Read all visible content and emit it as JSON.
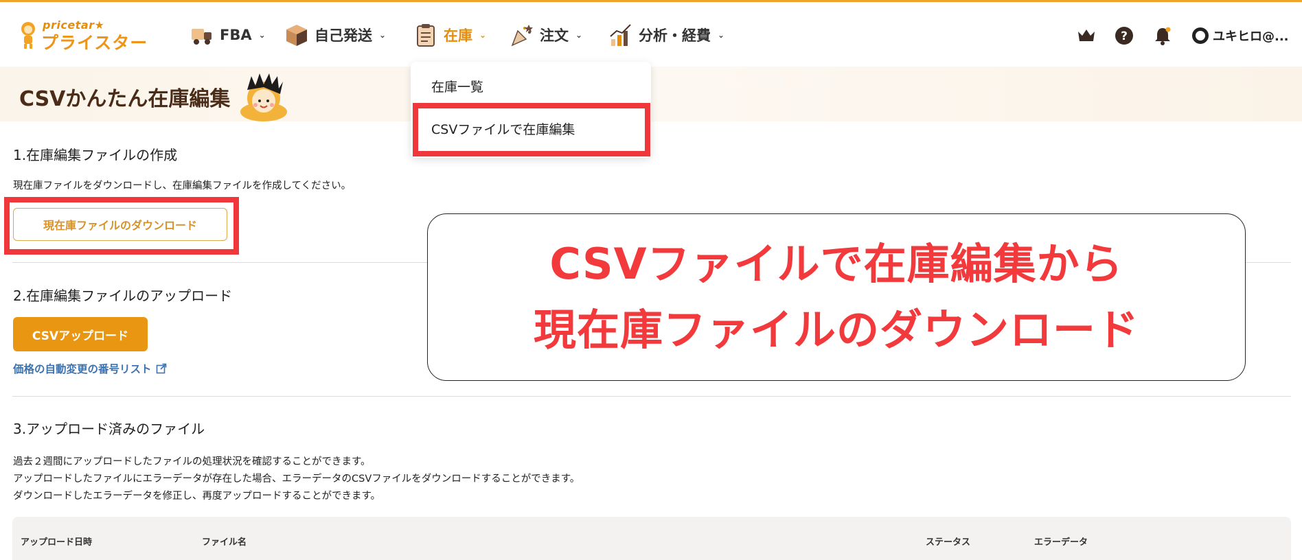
{
  "brand": {
    "logo_small": "pricetar★",
    "logo_big": "プライスター"
  },
  "nav": [
    {
      "label": "FBA",
      "icon": "truck-icon"
    },
    {
      "label": "自己発送",
      "icon": "box-icon"
    },
    {
      "label": "在庫",
      "icon": "clipboard-icon",
      "active": true
    },
    {
      "label": "注文",
      "icon": "party-popper-icon"
    },
    {
      "label": "分析・経費",
      "icon": "chart-icon"
    }
  ],
  "header_icons": [
    "crown-icon",
    "help-icon",
    "bell-icon"
  ],
  "user": {
    "name": "ユキヒロ@..."
  },
  "page": {
    "title": "CSVかんたん在庫編集"
  },
  "dropdown": {
    "items": [
      "在庫一覧",
      "CSVファイルで在庫編集"
    ]
  },
  "section1": {
    "heading": "1.在庫編集ファイルの作成",
    "description": "現在庫ファイルをダウンロードし、在庫編集ファイルを作成してください。",
    "button": "現在庫ファイルのダウンロード"
  },
  "section2": {
    "heading": "2.在庫編集ファイルのアップロード",
    "button": "CSVアップロード",
    "link": "価格の自動変更の番号リスト"
  },
  "section3": {
    "heading": "3.アップロード済みのファイル",
    "lines": [
      "過去２週間にアップロードしたファイルの処理状況を確認することができます。",
      "アップロードしたファイルにエラーデータが存在した場合、エラーデータのCSVファイルをダウンロードすることができます。",
      "ダウンロードしたエラーデータを修正し、再度アップロードすることができます。"
    ],
    "table_headers": [
      "アップロード日時",
      "ファイル名",
      "ステータス",
      "エラーデータ"
    ]
  },
  "callout": {
    "line1": "CSVファイルで在庫編集から",
    "line2": "現在庫ファイルのダウンロード"
  },
  "colors": {
    "accent": "#e99712",
    "highlight": "#f0383c",
    "link": "#3d73b0"
  }
}
